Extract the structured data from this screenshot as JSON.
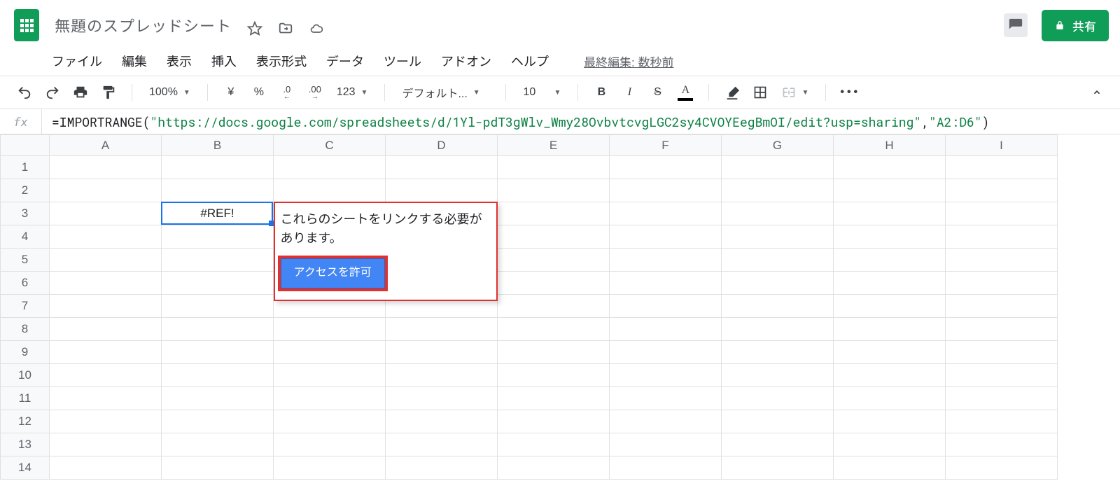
{
  "header": {
    "doc_title": "無題のスプレッドシート",
    "menus": {
      "file": "ファイル",
      "edit": "編集",
      "view": "表示",
      "insert": "挿入",
      "format": "表示形式",
      "data": "データ",
      "tools": "ツール",
      "addons": "アドオン",
      "help": "ヘルプ"
    },
    "last_edit": "最終編集: 数秒前",
    "share_label": "共有"
  },
  "toolbar": {
    "zoom": "100%",
    "currency_symbol": "¥",
    "percent": "%",
    "dec_less": ".0",
    "dec_more": ".00",
    "fmt123": "123",
    "font_name": "デフォルト...",
    "font_size": "10"
  },
  "formula": {
    "prefix": "=IMPORTRANGE(",
    "arg1": "\"https://docs.google.com/spreadsheets/d/1Yl-pdT3gWlv_Wmy28OvbvtcvgLGC2sy4CVOYEegBmOI/edit?usp=sharing\"",
    "sep": ", ",
    "arg2": "\"A2:D6\"",
    "suffix": ")"
  },
  "grid": {
    "columns": [
      "A",
      "B",
      "C",
      "D",
      "E",
      "F",
      "G",
      "H",
      "I"
    ],
    "row_count": 14,
    "active_cell": {
      "col": "B",
      "row": 3,
      "value": "#REF!"
    }
  },
  "popup": {
    "message": "これらのシートをリンクする必要があります。",
    "button": "アクセスを許可"
  },
  "colors": {
    "green": "#0f9d58",
    "blue": "#1a73e8",
    "red_border": "#e03030"
  }
}
